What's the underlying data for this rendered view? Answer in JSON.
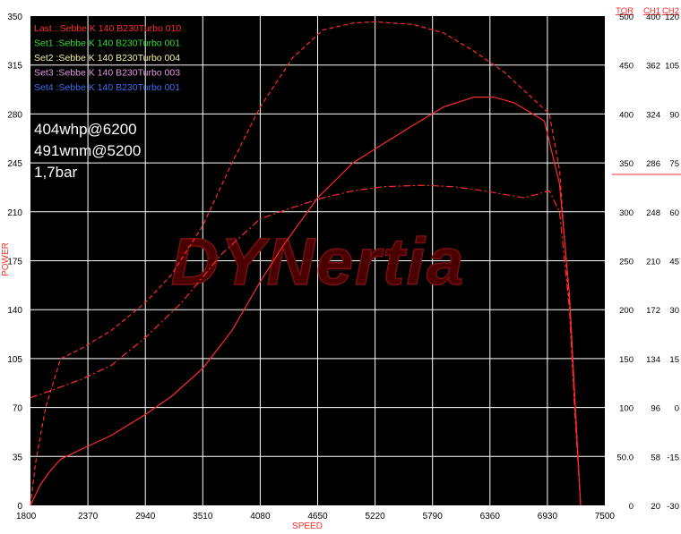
{
  "chart_data": {
    "type": "line",
    "xlabel": "SPEED",
    "ylabel": "POWER",
    "xlim": [
      1800,
      7500
    ],
    "ylim": [
      0,
      350
    ],
    "x_ticks": [
      "1800",
      "2370",
      "2940",
      "3510",
      "4080",
      "4650",
      "5220",
      "5790",
      "6360",
      "6930",
      "7500"
    ],
    "y_ticks": [
      "0",
      "35",
      "70",
      "105",
      "140",
      "175",
      "210",
      "245",
      "280",
      "315",
      "350"
    ],
    "grid": true,
    "legend": [
      {
        "label": "Last : Sebbe K 140 B230Turbo 010",
        "color": "#ff2a2a"
      },
      {
        "label": "Set1 :Sebbe K 140 B230Turbo 001",
        "color": "#33dd33"
      },
      {
        "label": "Set2 :Sebbe K 140 B230Turbo 004",
        "color": "#f2f2a0"
      },
      {
        "label": "Set3 :Sebbe K 140 B230Turbo 003",
        "color": "#e39ae3"
      },
      {
        "label": "Set4 :Sebbe K 140 B230Turbo 001",
        "color": "#3b6df0"
      }
    ],
    "annotations": [
      "404whp@6200",
      "491wnm@5200",
      "1,7bar"
    ],
    "watermark": "DYNertia",
    "right_axes": [
      {
        "header": "TOR",
        "ticks": [
          "500",
          "450",
          "400",
          "350",
          "300",
          "250",
          "200",
          "150",
          "100",
          "50.0",
          "0"
        ]
      },
      {
        "header": "CH1",
        "ticks": [
          "400",
          "362",
          "324",
          "286",
          "248",
          "210",
          "172",
          "134",
          "96",
          "58",
          "20"
        ]
      },
      {
        "header": "CH2",
        "ticks": [
          "120",
          "105",
          "90",
          "75",
          "60",
          "45",
          "30",
          "15",
          "0",
          "-15",
          "-30"
        ]
      }
    ],
    "series": [
      {
        "style": "solid",
        "color": "#ff2a2a",
        "x": [
          1800,
          1900,
          2000,
          2100,
          2300,
          2600,
          2940,
          3200,
          3510,
          3800,
          4080,
          4300,
          4650,
          5000,
          5220,
          5600,
          5900,
          6200,
          6400,
          6600,
          6900,
          7050,
          7150,
          7200,
          7260
        ],
        "y": [
          0,
          15,
          25,
          33,
          40,
          50,
          65,
          78,
          98,
          125,
          160,
          185,
          220,
          245,
          255,
          272,
          285,
          292,
          292,
          288,
          275,
          230,
          150,
          80,
          0
        ]
      },
      {
        "style": "dashed",
        "color": "#ff2a2a",
        "x": [
          1800,
          1850,
          1950,
          2100,
          2300,
          2600,
          2940,
          3200,
          3510,
          3800,
          4080,
          4400,
          4700,
          5000,
          5220,
          5600,
          5900,
          6200,
          6500,
          6800,
          6950,
          7050,
          7150,
          7200,
          7260
        ],
        "y": [
          0,
          30,
          70,
          105,
          112,
          125,
          145,
          165,
          200,
          245,
          285,
          320,
          340,
          345,
          346,
          344,
          338,
          325,
          310,
          290,
          280,
          240,
          140,
          70,
          0
        ]
      },
      {
        "style": "dashdot",
        "color": "#ff2a2a",
        "x": [
          1800,
          2000,
          2300,
          2600,
          2940,
          3300,
          3700,
          4080,
          4400,
          4700,
          5000,
          5300,
          5700,
          6000,
          6300,
          6700,
          6950,
          7050,
          7150,
          7200,
          7260
        ],
        "y": [
          77,
          82,
          90,
          100,
          120,
          145,
          180,
          205,
          213,
          220,
          225,
          228,
          229,
          228,
          225,
          220,
          225,
          210,
          140,
          70,
          0
        ]
      }
    ]
  }
}
